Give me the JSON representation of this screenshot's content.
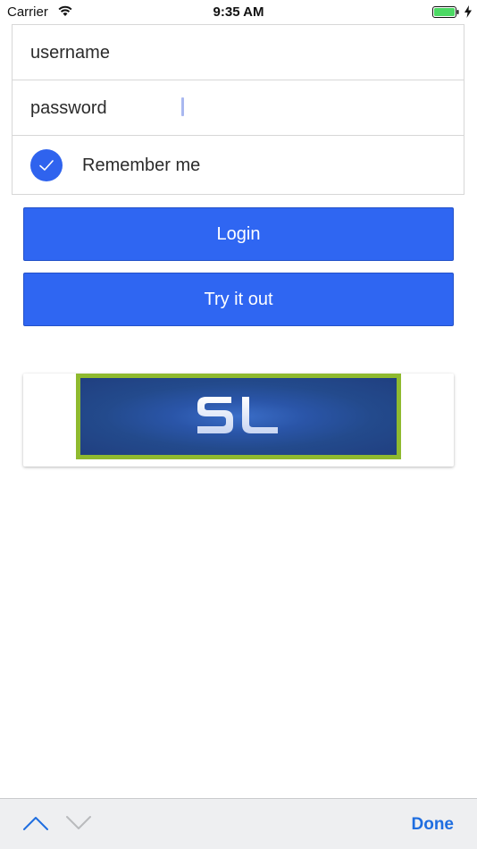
{
  "status_bar": {
    "carrier": "Carrier",
    "time": "9:35 AM",
    "battery_color": "#4cd964"
  },
  "form": {
    "username_placeholder": "username",
    "password_placeholder": "password",
    "remember_label": "Remember me",
    "remember_checked": true
  },
  "buttons": {
    "login_label": "Login",
    "try_label": "Try it out"
  },
  "accessory_bar": {
    "done_label": "Done"
  },
  "colors": {
    "accent": "#2f66f2",
    "logo_border": "#8fba2f",
    "logo_background": "#234a8c",
    "done_text": "#1f6ee0"
  },
  "icons": {
    "wifi": "wifi-icon",
    "battery": "battery-icon",
    "charging": "bolt-icon",
    "checkbox": "checkmark-icon",
    "previous": "chevron-up-icon",
    "next": "chevron-down-icon"
  }
}
